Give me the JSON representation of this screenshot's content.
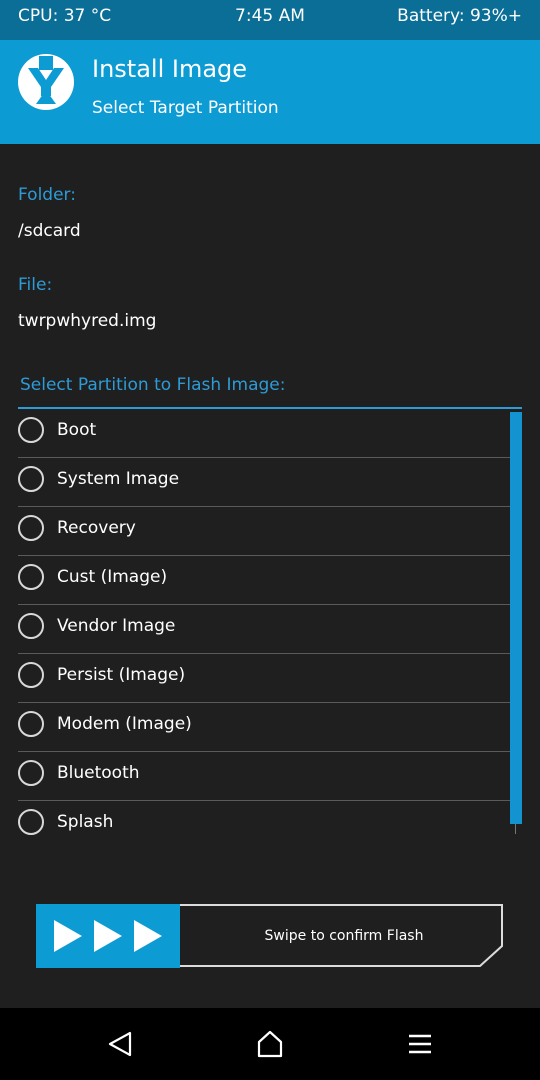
{
  "status_bar": {
    "cpu": "CPU: 37 °C",
    "time": "7:45 AM",
    "battery": "Battery: 93%+"
  },
  "header": {
    "title": "Install Image",
    "subtitle": "Select Target Partition"
  },
  "folder": {
    "label": "Folder:",
    "value": "/sdcard"
  },
  "file": {
    "label": "File:",
    "value": "twrpwhyred.img"
  },
  "partition_list": {
    "heading": "Select Partition to Flash Image:",
    "items": [
      {
        "label": "Boot",
        "selected": false
      },
      {
        "label": "System Image",
        "selected": false
      },
      {
        "label": "Recovery",
        "selected": false
      },
      {
        "label": "Cust (Image)",
        "selected": false
      },
      {
        "label": "Vendor Image",
        "selected": false
      },
      {
        "label": "Persist (Image)",
        "selected": false
      },
      {
        "label": "Modem (Image)",
        "selected": false
      },
      {
        "label": "Bluetooth",
        "selected": false
      },
      {
        "label": "Splash",
        "selected": false
      }
    ]
  },
  "swipe": {
    "label": "Swipe to confirm Flash"
  },
  "nav": {
    "back": "back-icon",
    "home": "home-icon",
    "menu": "menu-icon"
  },
  "colors": {
    "accent": "#0d9bd3",
    "status_bar": "#0a6e97",
    "background": "#1f1f1f",
    "label": "#2e9bd6"
  }
}
